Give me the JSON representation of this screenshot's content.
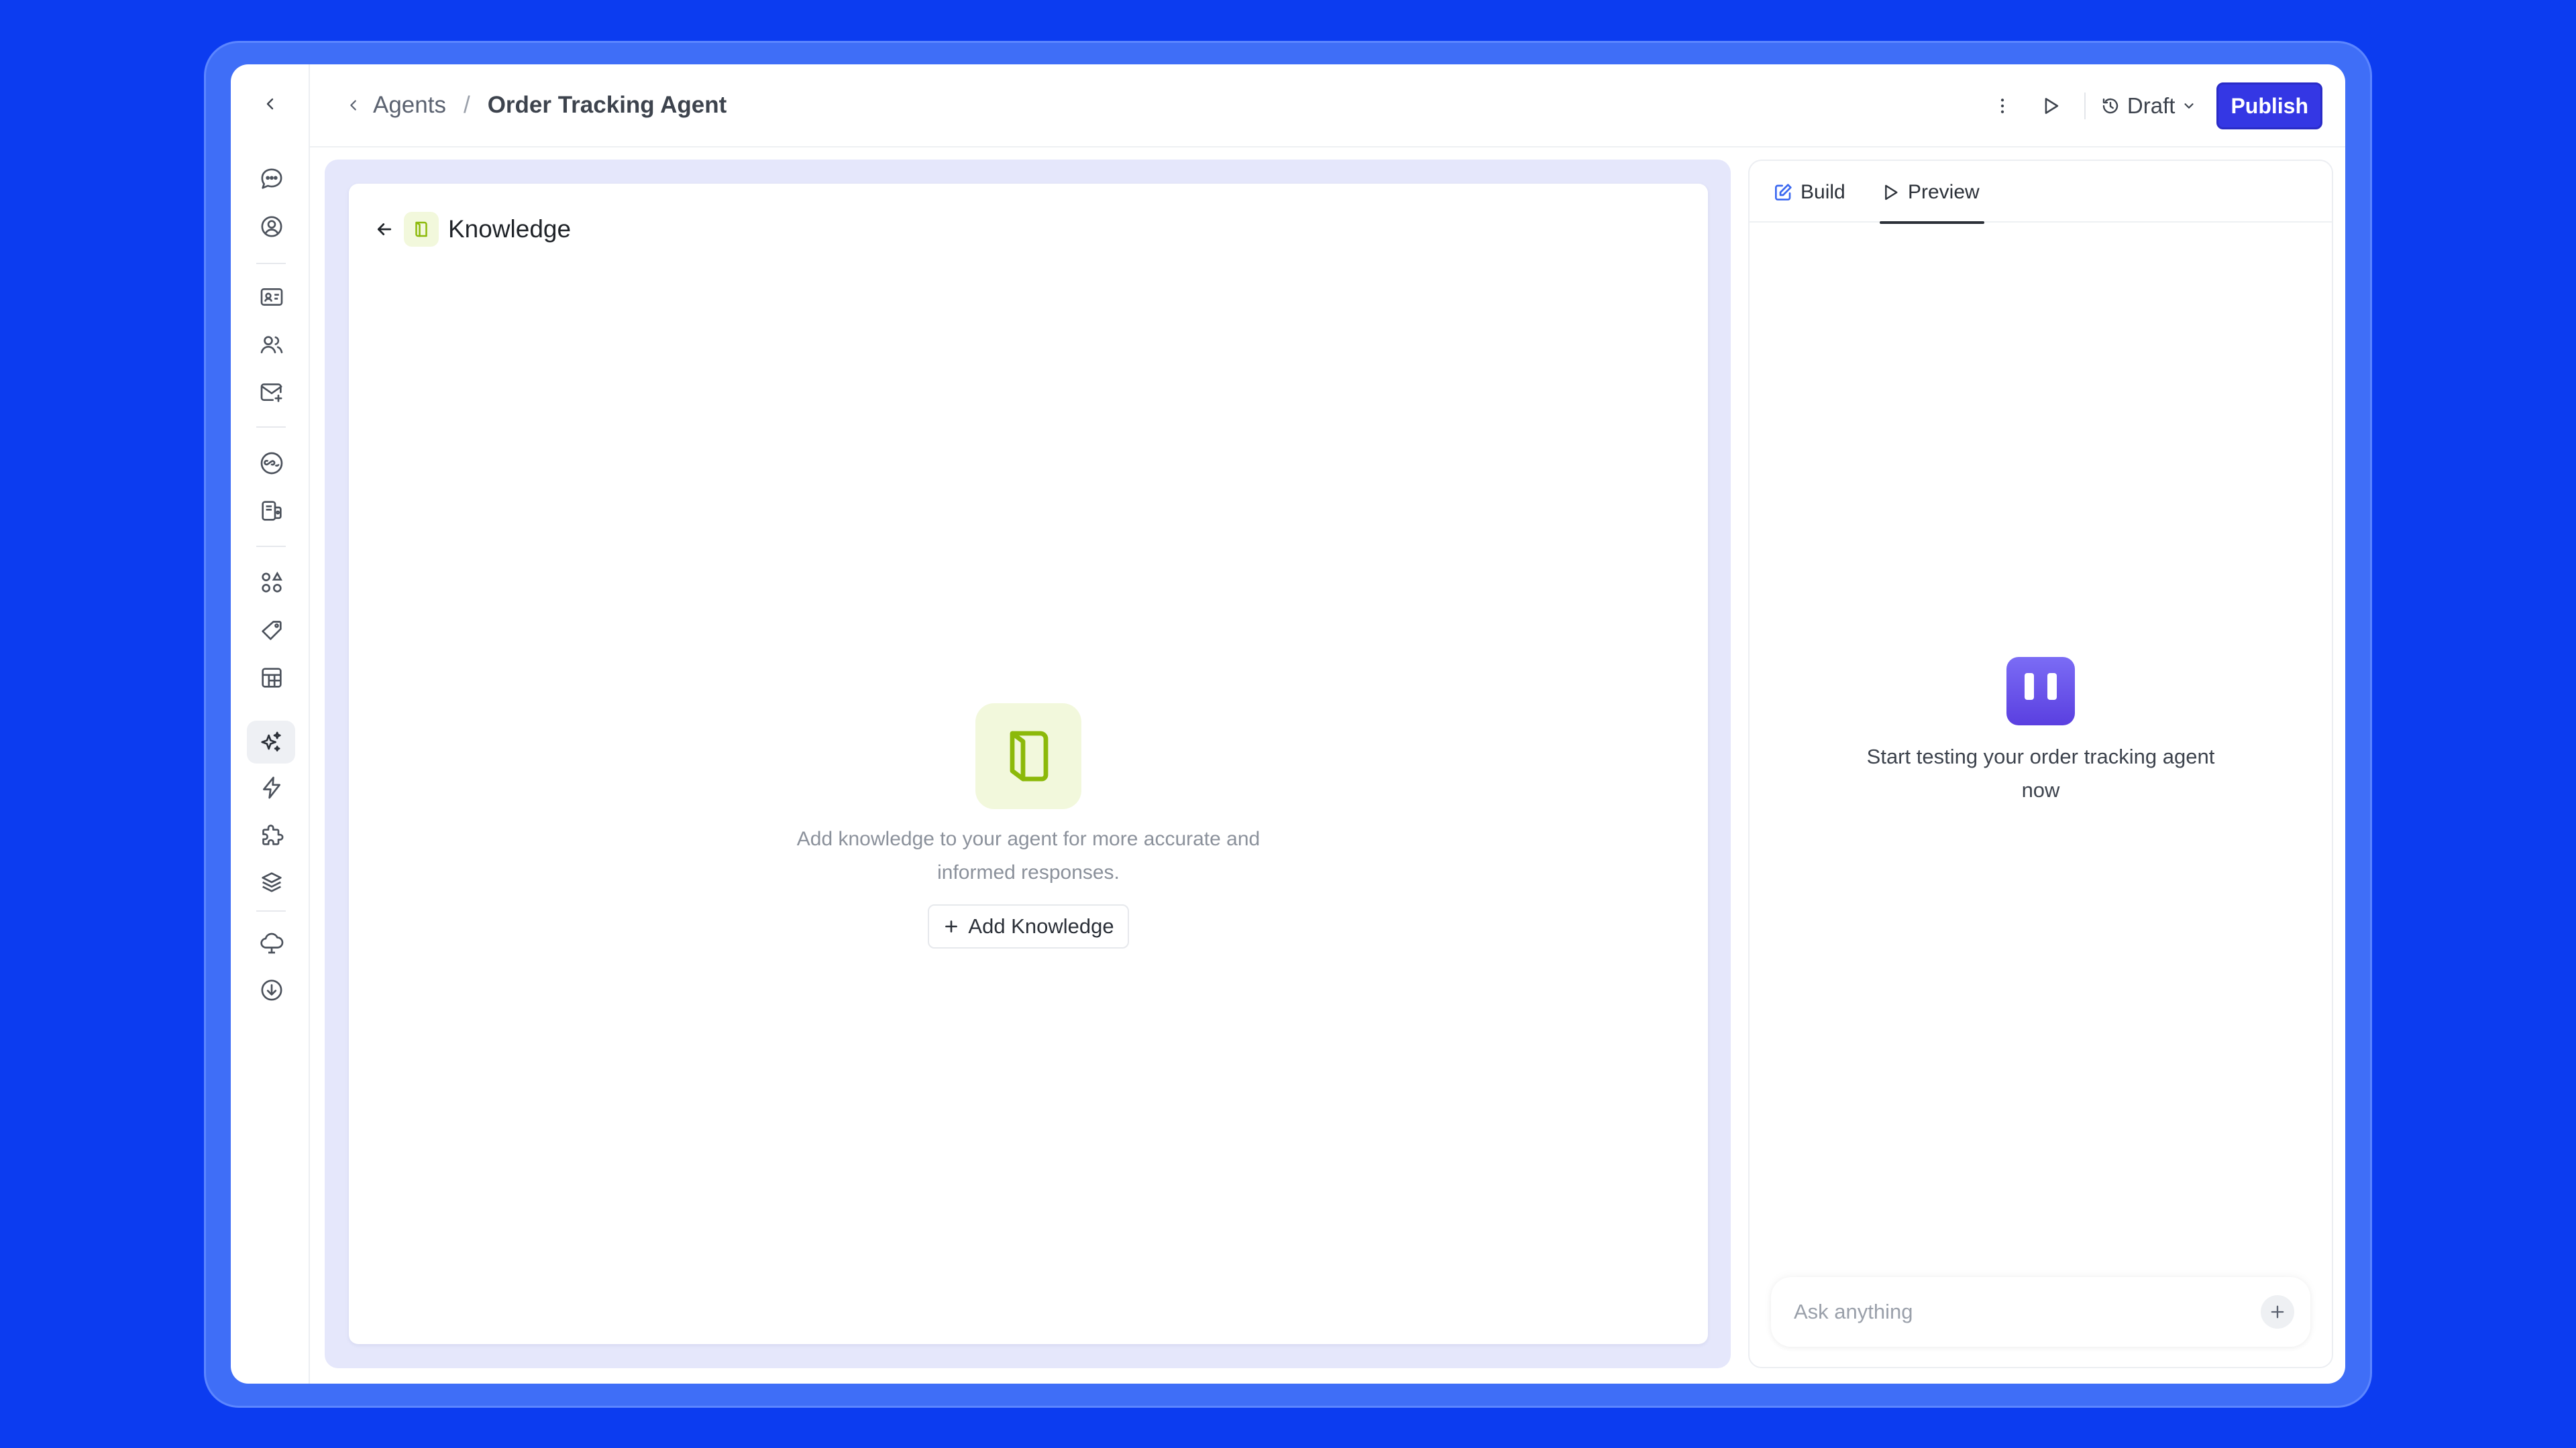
{
  "topbar": {
    "breadcrumb": {
      "parent": "Agents",
      "separator": "/",
      "current": "Order Tracking Agent"
    },
    "draft_label": "Draft",
    "publish_label": "Publish"
  },
  "sidebar": {
    "icons": [
      "chat-bubble-icon",
      "user-circle-icon",
      "contact-card-icon",
      "users-icon",
      "mail-icon",
      "infinity-icon",
      "kiosk-icon",
      "apps-icon",
      "tag-icon",
      "table-icon",
      "sparkles-icon",
      "bolt-icon",
      "puzzle-icon",
      "layers-icon",
      "cloud-icon",
      "download-icon"
    ],
    "active": "sparkles-icon"
  },
  "knowledge": {
    "title": "Knowledge",
    "empty_text": "Add knowledge to your agent  for more accurate and informed responses.",
    "add_button": "Add Knowledge"
  },
  "preview_panel": {
    "tabs": [
      {
        "label": "Build"
      },
      {
        "label": "Preview"
      }
    ],
    "active_tab": "Preview",
    "start_text": "Start testing your order tracking agent now",
    "input_placeholder": "Ask anything"
  },
  "colors": {
    "background": "#0c3cf0",
    "accent": "#3437e4",
    "knowledge_green": "#8cb90a",
    "logo_purple": "#6a52ea"
  }
}
